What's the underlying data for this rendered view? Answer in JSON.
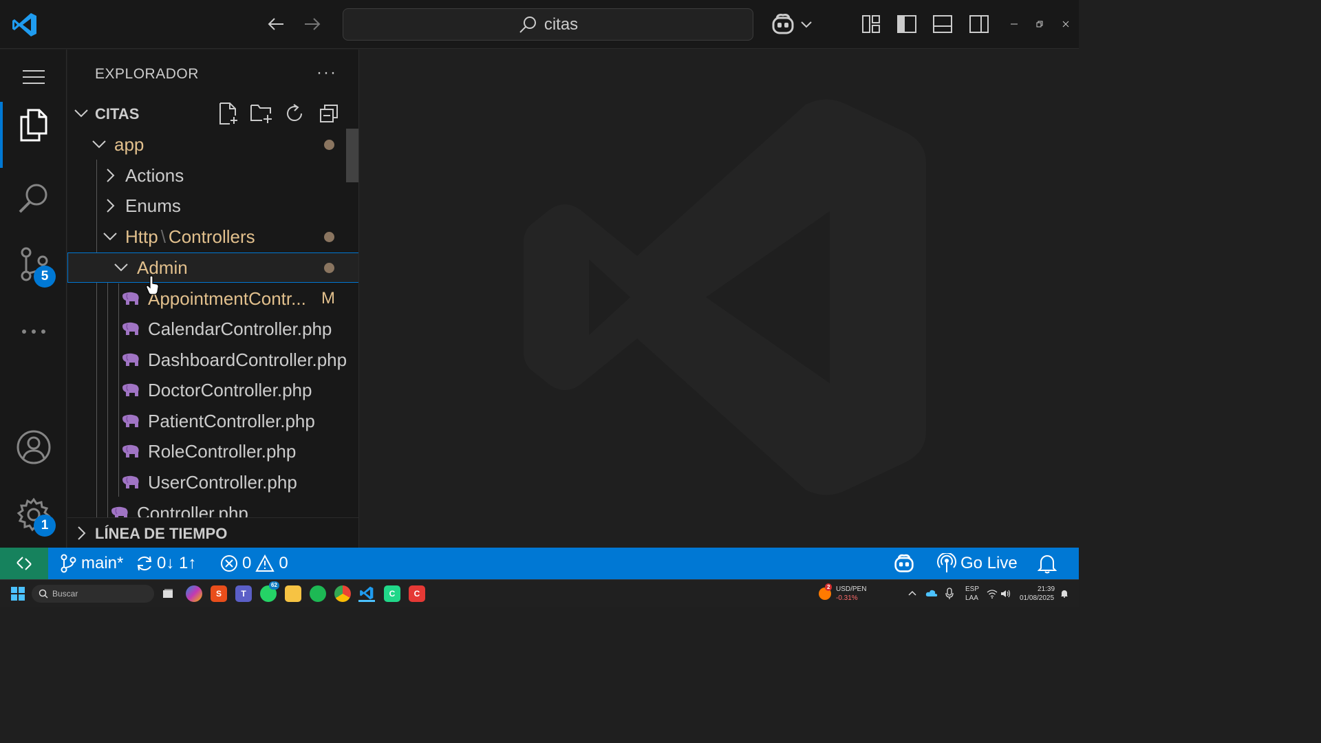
{
  "titlebar": {
    "search_text": "citas"
  },
  "activity": {
    "scm_badge": "5",
    "settings_badge": "1"
  },
  "explorer": {
    "title": "EXPLORADOR",
    "more": "···",
    "project": "CITAS",
    "tree": {
      "app": "app",
      "actions": "Actions",
      "enums": "Enums",
      "http": "Http",
      "sep": "\\",
      "controllers": "Controllers",
      "admin": "Admin",
      "files": [
        "AppointmentContr...",
        "CalendarController.php",
        "DashboardController.php",
        "DoctorController.php",
        "PatientController.php",
        "RoleController.php",
        "UserController.php"
      ],
      "modified_flag": "M",
      "controller_php": "Controller.php"
    },
    "timeline": "LÍNEA DE TIEMPO"
  },
  "status": {
    "branch": "main*",
    "sync": "0↓ 1↑",
    "errors": "0",
    "warnings": "0",
    "golive": "Go Live"
  },
  "taskbar": {
    "search_placeholder": "Buscar",
    "whatsapp_badge": "62",
    "currency_badge": "2",
    "currency_pair": "USD/PEN",
    "currency_change": "-0.31%",
    "lang_top": "ESP",
    "lang_bottom": "LAA",
    "time": "21:39",
    "date": "01/08/2025"
  },
  "colors": {
    "accent": "#0078d4",
    "remote": "#16825d",
    "modified": "#e2c08d",
    "php_icon": "#a074c4"
  }
}
